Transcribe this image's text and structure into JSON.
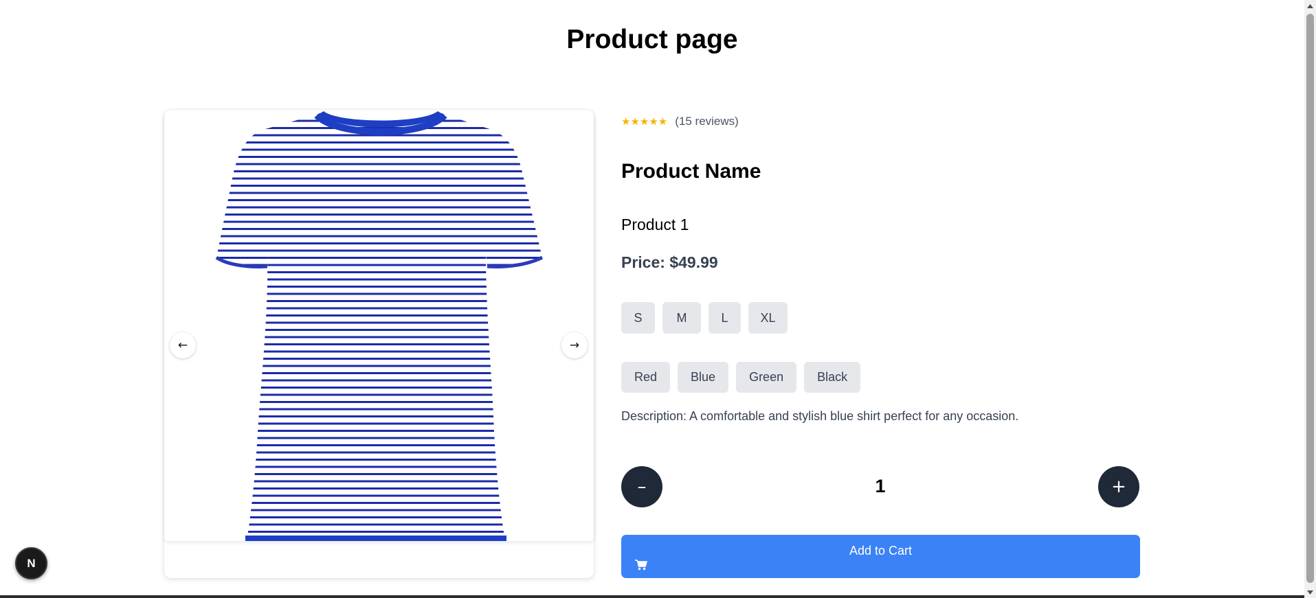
{
  "page": {
    "title": "Product page"
  },
  "gallery": {
    "prev_label": "←",
    "next_label": "→",
    "image_icon": "striped-blue-tshirt-image"
  },
  "product": {
    "rating_stars": "★★★★★",
    "rating_value": 5,
    "reviews": "(15 reviews)",
    "heading": "Product Name",
    "name": "Product 1",
    "price": "Price: $49.99",
    "sizes": [
      "S",
      "M",
      "L",
      "XL"
    ],
    "colors": [
      "Red",
      "Blue",
      "Green",
      "Black"
    ],
    "description": "Description: A comfortable and stylish blue shirt perfect for any occasion."
  },
  "quantity": {
    "minus_label": "–",
    "plus_label": "+",
    "value": "1"
  },
  "cart": {
    "label": "Add to Cart",
    "icon": "cart-icon"
  },
  "devtools": {
    "badge_label": "N"
  },
  "colors": {
    "primary_button": "#3b82f6",
    "dark_button": "#1f2937",
    "chip_bg": "#e5e7eb",
    "star": "#f5b301"
  }
}
